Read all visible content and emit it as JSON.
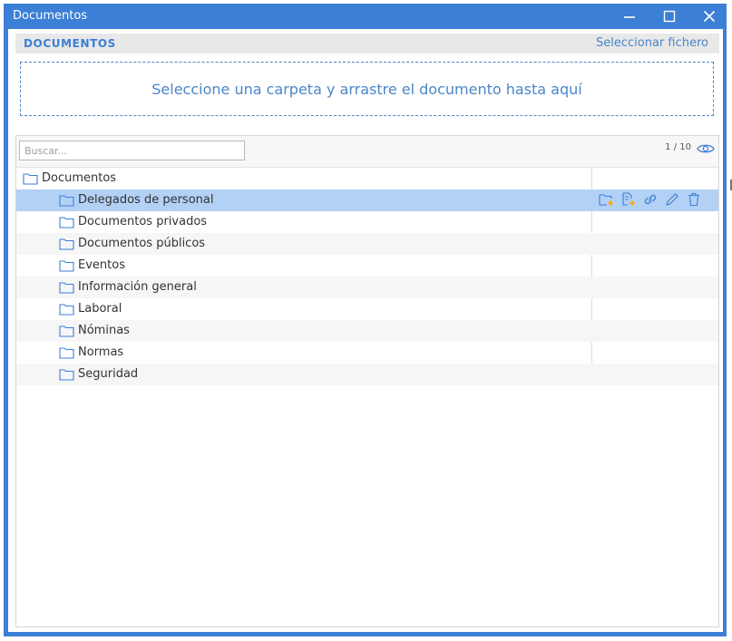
{
  "window": {
    "title": "Documentos",
    "controls": [
      "minimize-icon",
      "maximize-icon",
      "close-icon"
    ]
  },
  "header": {
    "label": "DOCUMENTOS",
    "select_file": "Seleccionar fichero"
  },
  "dropzone": {
    "text": "Seleccione una carpeta y arrastre el documento hasta aquí"
  },
  "toolbar": {
    "search_placeholder": "Buscar...",
    "pager": "1 / 10",
    "view_icon": "eye-icon"
  },
  "tree": {
    "root": "Documentos",
    "items": [
      {
        "label": "Delegados de personal",
        "selected": true
      },
      {
        "label": "Documentos privados"
      },
      {
        "label": "Documentos públicos"
      },
      {
        "label": "Eventos"
      },
      {
        "label": "Información general"
      },
      {
        "label": "Laboral"
      },
      {
        "label": "Nóminas"
      },
      {
        "label": "Normas"
      },
      {
        "label": "Seguridad"
      }
    ],
    "row_actions": [
      "add-folder-icon",
      "add-document-icon",
      "link-icon",
      "edit-icon",
      "delete-icon"
    ]
  },
  "colors": {
    "accent": "#3c7fd6",
    "selected_row": "#b3d1f5",
    "action_orange": "#f5a623"
  }
}
